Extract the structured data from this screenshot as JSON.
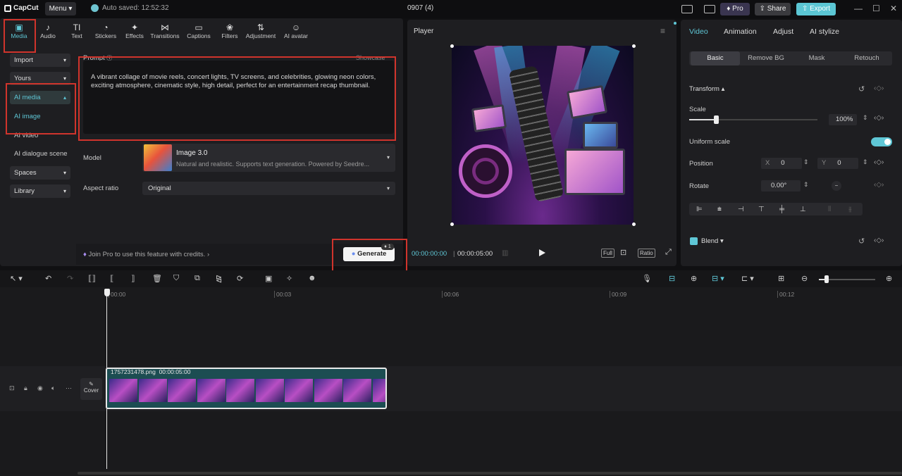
{
  "app": {
    "logo": "CapCut",
    "menu_label": "Menu",
    "autosave": "Auto saved: 12:52:32",
    "project_title": "0907 (4)"
  },
  "top_actions": {
    "pro": "Pro",
    "share": "Share",
    "export": "Export"
  },
  "toolbar": [
    {
      "label": "Media",
      "icon": "media-icon",
      "glyph": "▣"
    },
    {
      "label": "Audio",
      "icon": "audio-icon",
      "glyph": "♪"
    },
    {
      "label": "Text",
      "icon": "text-icon",
      "glyph": "TI"
    },
    {
      "label": "Stickers",
      "icon": "stickers-icon",
      "glyph": "◔"
    },
    {
      "label": "Effects",
      "icon": "effects-icon",
      "glyph": "✦"
    },
    {
      "label": "Transitions",
      "icon": "transitions-icon",
      "glyph": "⋈"
    },
    {
      "label": "Captions",
      "icon": "captions-icon",
      "glyph": "▭"
    },
    {
      "label": "Filters",
      "icon": "filters-icon",
      "glyph": "❀"
    },
    {
      "label": "Adjustment",
      "icon": "adjustment-icon",
      "glyph": "⇅"
    },
    {
      "label": "AI avatar",
      "icon": "ai-avatar-icon",
      "glyph": "☺"
    }
  ],
  "sidebar": {
    "import": "Import",
    "yours": "Yours",
    "ai_media": "AI media",
    "ai_image": "AI image",
    "ai_video": "AI video",
    "ai_dialogue": "AI dialogue scene",
    "spaces": "Spaces",
    "library": "Library"
  },
  "prompt": {
    "label": "Prompt",
    "showcase": "Showcase",
    "text": "A vibrant collage of movie reels, concert lights, TV screens, and celebrities, glowing neon colors, exciting atmosphere, cinematic style, high detail, perfect for an entertainment recap thumbnail."
  },
  "model": {
    "label": "Model",
    "name": "Image 3.0",
    "description": "Natural and realistic. Supports text generation. Powered by Seedre..."
  },
  "aspect": {
    "label": "Aspect ratio",
    "value": "Original"
  },
  "pro_strip": {
    "text": "Join Pro to use this feature with credits.",
    "generate": "Generate",
    "badge": "1"
  },
  "player": {
    "title": "Player",
    "time_current": "00:00:00:00",
    "time_total": "00:00:05:00",
    "full": "Full",
    "ratio": "Ratio"
  },
  "right_panel": {
    "tabs": [
      "Video",
      "Animation",
      "Adjust",
      "AI stylize"
    ],
    "subtabs": [
      "Basic",
      "Remove BG",
      "Mask",
      "Retouch"
    ],
    "transform": "Transform",
    "scale_label": "Scale",
    "scale_value": "100%",
    "scale_level": 1.0,
    "uniform_scale": "Uniform scale",
    "position_label": "Position",
    "pos_x_label": "X",
    "pos_x": "0",
    "pos_y_label": "Y",
    "pos_y": "0",
    "rotate_label": "Rotate",
    "rotate_value": "0.00°",
    "blend": "Blend"
  },
  "timeline": {
    "ruler": [
      "00:00",
      "00:03",
      "00:06",
      "00:09",
      "00:12"
    ],
    "clip_name": "1757231478.png",
    "clip_duration": "00:00:05:00",
    "cover": "Cover"
  }
}
